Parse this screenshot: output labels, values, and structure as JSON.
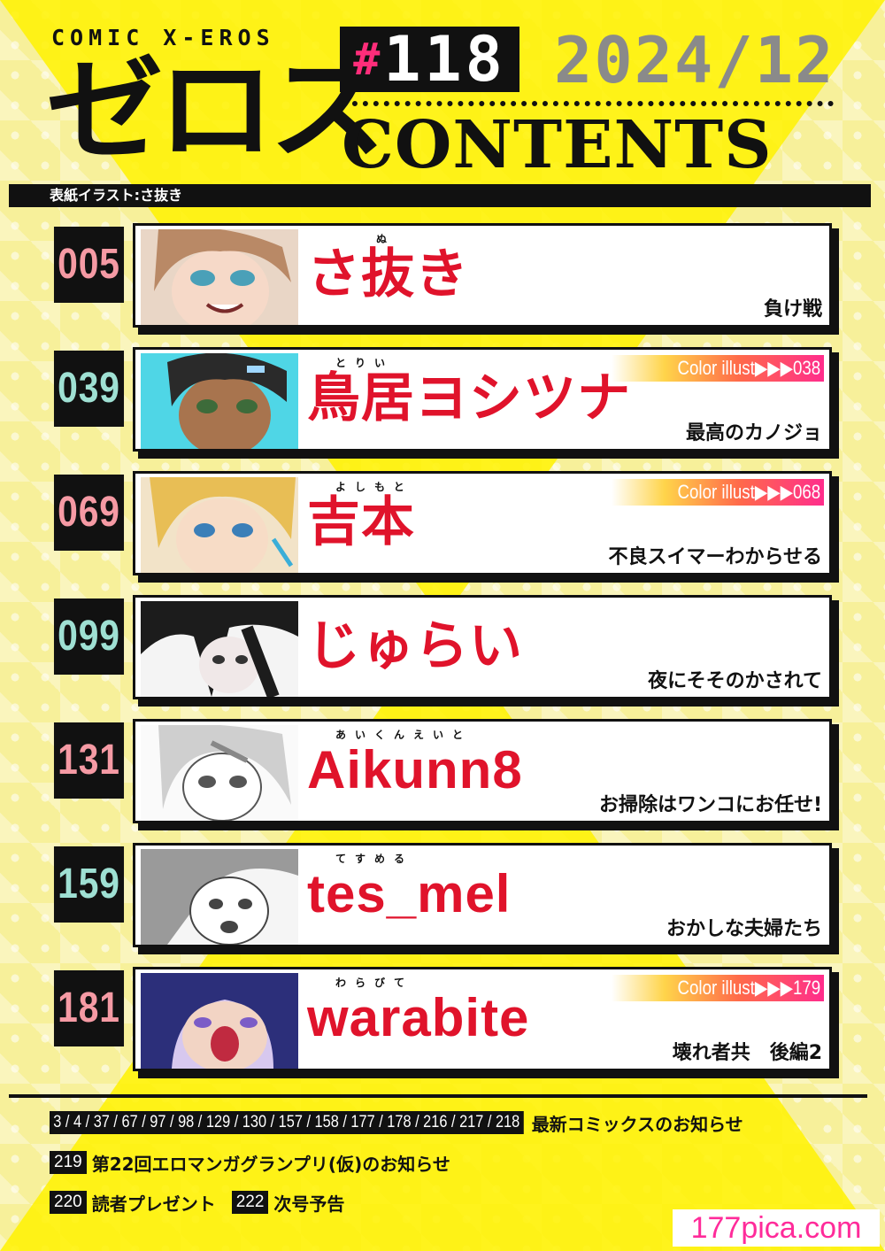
{
  "header": {
    "logo_en": "COMIC X-EROS",
    "logo_jp": "ゼロス",
    "issue_hash": "#",
    "issue_number": "118",
    "date": "2024/12",
    "contents_label": "CONTENTS",
    "cover_credit": "表紙イラスト:さ抜き"
  },
  "entries": [
    {
      "page": "005",
      "ruby": "ぬ",
      "author": "さ抜き",
      "title": "負け戦",
      "badge": ""
    },
    {
      "page": "039",
      "ruby": "とりい",
      "author": "鳥居ヨシツナ",
      "title": "最高のカノジョ",
      "badge": "Color illust▶▶▶038"
    },
    {
      "page": "069",
      "ruby": "よしもと",
      "author": "吉本",
      "title": "不良スイマーわからせる",
      "badge": "Color illust▶▶▶068"
    },
    {
      "page": "099",
      "ruby": "",
      "author": "じゅらい",
      "title": "夜にそそのかされて",
      "badge": ""
    },
    {
      "page": "131",
      "ruby": "あいくんえいと",
      "author": "Aikunn8",
      "title": "お掃除はワンコにお任せ!",
      "badge": ""
    },
    {
      "page": "159",
      "ruby": "てすめる",
      "author": "tes_mel",
      "title": "おかしな夫婦たち",
      "badge": ""
    },
    {
      "page": "181",
      "ruby": "わらびて",
      "author": "warabite",
      "title": "壊れ者共　後編2",
      "badge": "Color illust▶▶▶179"
    }
  ],
  "footer": {
    "row1_pages": "3 / 4 / 37 / 67 / 97 / 98 / 129 / 130 / 157 / 158 / 177 / 178 / 216 / 217 / 218",
    "row1_text": "最新コミックスのお知らせ",
    "row2_page": "219",
    "row2_text": "第22回エロマンガグランプリ(仮)のお知らせ",
    "row3_page1": "220",
    "row3_text1": "読者プレゼント",
    "row3_page2": "222",
    "row3_text2": "次号予告"
  },
  "watermark": "177pica.com",
  "colors": {
    "background": "#f7f09a",
    "accent_yellow": "#fff200",
    "author_red": "#e0132b",
    "page_pink": "#f59aa4",
    "page_teal": "#9fe0d3",
    "hash_pink": "#ff2d7a",
    "watermark_pink": "#ff2b9a"
  }
}
